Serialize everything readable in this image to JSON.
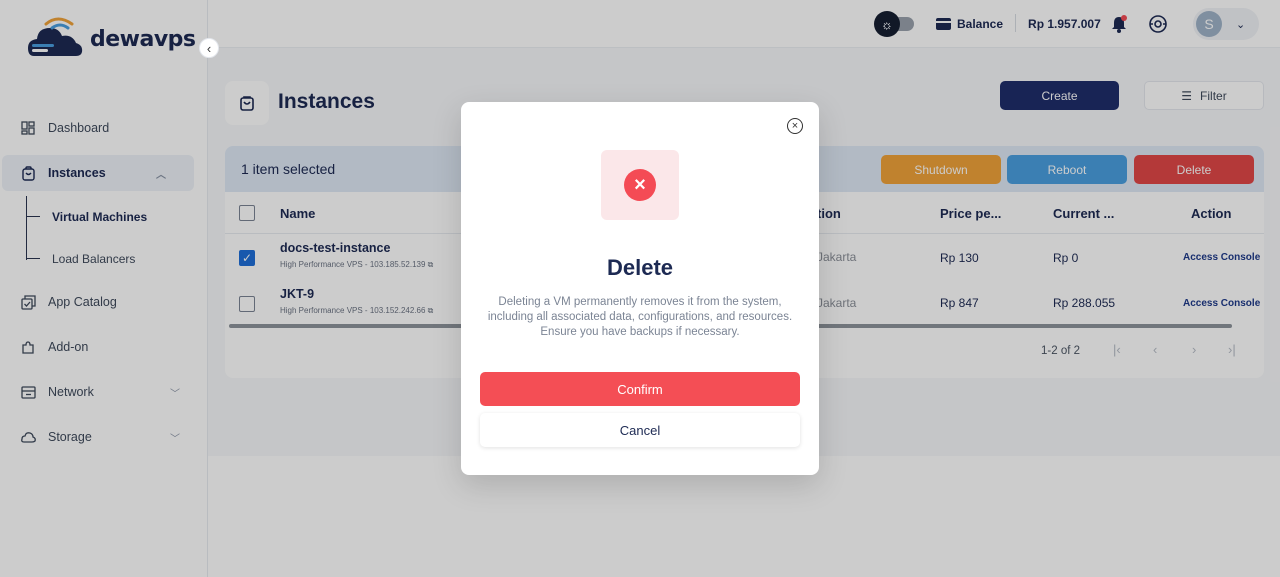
{
  "brand": {
    "name": "dewavps"
  },
  "sidebar": {
    "items": [
      {
        "label": "Dashboard",
        "icon": "grid-icon"
      },
      {
        "label": "Instances",
        "icon": "bag-icon"
      },
      {
        "label": "App Catalog",
        "icon": "catalog-icon"
      },
      {
        "label": "Add-on",
        "icon": "puzzle-icon"
      },
      {
        "label": "Network",
        "icon": "network-icon"
      },
      {
        "label": "Storage",
        "icon": "storage-icon"
      }
    ],
    "subitems": [
      {
        "label": "Virtual Machines"
      },
      {
        "label": "Load Balancers"
      }
    ]
  },
  "header": {
    "balance_label": "Balance",
    "balance_amount": "Rp 1.957.007",
    "avatar_initial": "S"
  },
  "page": {
    "title": "Instances",
    "create_label": "Create",
    "filter_label": "Filter"
  },
  "selection": {
    "text": "1 item selected",
    "shutdown_label": "Shutdown",
    "reboot_label": "Reboot",
    "delete_label": "Delete"
  },
  "table": {
    "headers": [
      "Name",
      "tion",
      "Price pe...",
      "Current ...",
      "Action"
    ],
    "rows": [
      {
        "name": "docs-test-instance",
        "sub": "High Performance VPS - 103.185.52.139",
        "location": "Jakarta",
        "price": "Rp 130",
        "current": "Rp 0",
        "action": "Access Console",
        "checked": true
      },
      {
        "name": "JKT-9",
        "sub": "High Performance VPS - 103.152.242.66",
        "location": "Jakarta",
        "price": "Rp 847",
        "current": "Rp 288.055",
        "action": "Access Console",
        "checked": false
      }
    ],
    "pagination": "1-2 of 2"
  },
  "modal": {
    "title": "Delete",
    "description": "Deleting a VM permanently removes it from the system, including all associated data, configurations, and resources. Ensure you have backups if necessary.",
    "confirm_label": "Confirm",
    "cancel_label": "Cancel"
  },
  "colors": {
    "primary": "#1e2d6b",
    "danger": "#f44e55",
    "warning": "#f0a33a",
    "info": "#4a9fe0"
  }
}
